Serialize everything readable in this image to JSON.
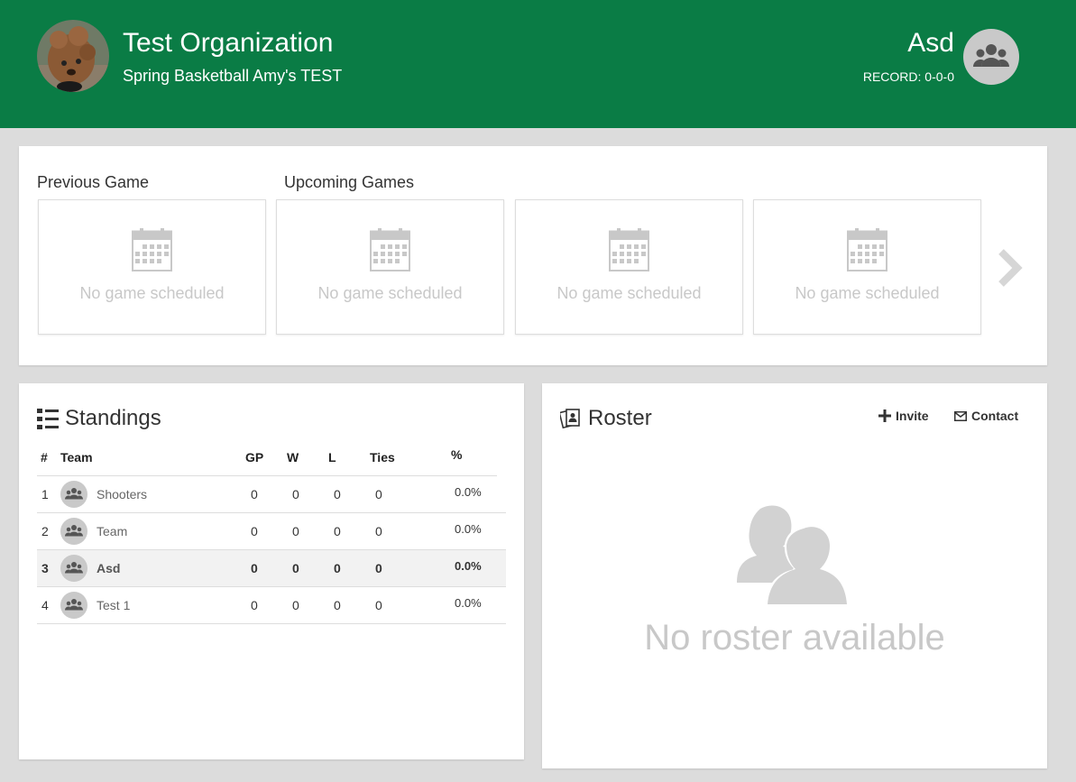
{
  "header": {
    "org_name": "Test Organization",
    "org_subtitle": "Spring Basketball Amy's TEST",
    "team_name": "Asd",
    "record": "RECORD: 0-0-0",
    "background_color": "#0a7c45"
  },
  "games": {
    "previous_label": "Previous Game",
    "upcoming_label": "Upcoming Games",
    "cards": [
      {
        "icon": "calendar-icon",
        "text": "No game scheduled"
      },
      {
        "icon": "calendar-icon",
        "text": "No game scheduled"
      },
      {
        "icon": "calendar-icon",
        "text": "No game scheduled"
      },
      {
        "icon": "calendar-icon",
        "text": "No game scheduled"
      }
    ]
  },
  "standings": {
    "title": "Standings",
    "columns": {
      "rank": "#",
      "team": "Team",
      "gp": "GP",
      "w": "W",
      "l": "L",
      "ties": "Ties",
      "pct": "%"
    },
    "rows": [
      {
        "rank": "1",
        "team": "Shooters",
        "gp": "0",
        "w": "0",
        "l": "0",
        "ties": "0",
        "pct": "0.0%",
        "current": false
      },
      {
        "rank": "2",
        "team": "Team",
        "gp": "0",
        "w": "0",
        "l": "0",
        "ties": "0",
        "pct": "0.0%",
        "current": false
      },
      {
        "rank": "3",
        "team": "Asd",
        "gp": "0",
        "w": "0",
        "l": "0",
        "ties": "0",
        "pct": "0.0%",
        "current": true
      },
      {
        "rank": "4",
        "team": "Test 1",
        "gp": "0",
        "w": "0",
        "l": "0",
        "ties": "0",
        "pct": "0.0%",
        "current": false
      }
    ]
  },
  "roster": {
    "title": "Roster",
    "invite_label": "Invite",
    "contact_label": "Contact",
    "empty_text": "No roster available"
  }
}
